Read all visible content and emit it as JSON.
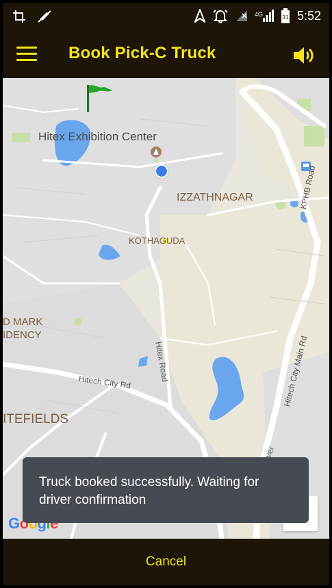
{
  "status_bar": {
    "time": "5:52",
    "network": "4G",
    "icons": [
      "crop-icon",
      "no-location-icon",
      "navigation-icon",
      "alarm-icon",
      "signal-icon",
      "signal-4g-icon",
      "battery-icon"
    ]
  },
  "toolbar": {
    "title": "Book Pick-C Truck",
    "menu_icon": "hamburger-menu-icon",
    "sound_icon": "speaker-icon"
  },
  "map": {
    "labels": {
      "hitex": "Hitex Exhibition Center",
      "izzathnagar": "IZZATHNAGAR",
      "kothaguda": "KOTHAGUDA",
      "mark": "D MARK",
      "idency": "IDENCY",
      "itefields": "ITEFIELDS"
    },
    "roads": {
      "kphb": "KPHB Road",
      "hitex_road": "Hitex Road",
      "hitech_main": "Hitech City Main Rd",
      "hitech_city": "Hitech City Rd",
      "over": "over"
    },
    "google": [
      "G",
      "o",
      "o",
      "g",
      "l",
      "e"
    ],
    "colors": {
      "land": "#e8e6dd",
      "urban": "#dedede",
      "water": "#6aa6ee",
      "park": "#c8dfa8",
      "road": "#ffffff",
      "accent": "#f4e41c"
    }
  },
  "toast": {
    "message": "Truck booked successfully. Waiting for driver confirmation"
  },
  "bottom": {
    "cancel_label": "Cancel"
  }
}
